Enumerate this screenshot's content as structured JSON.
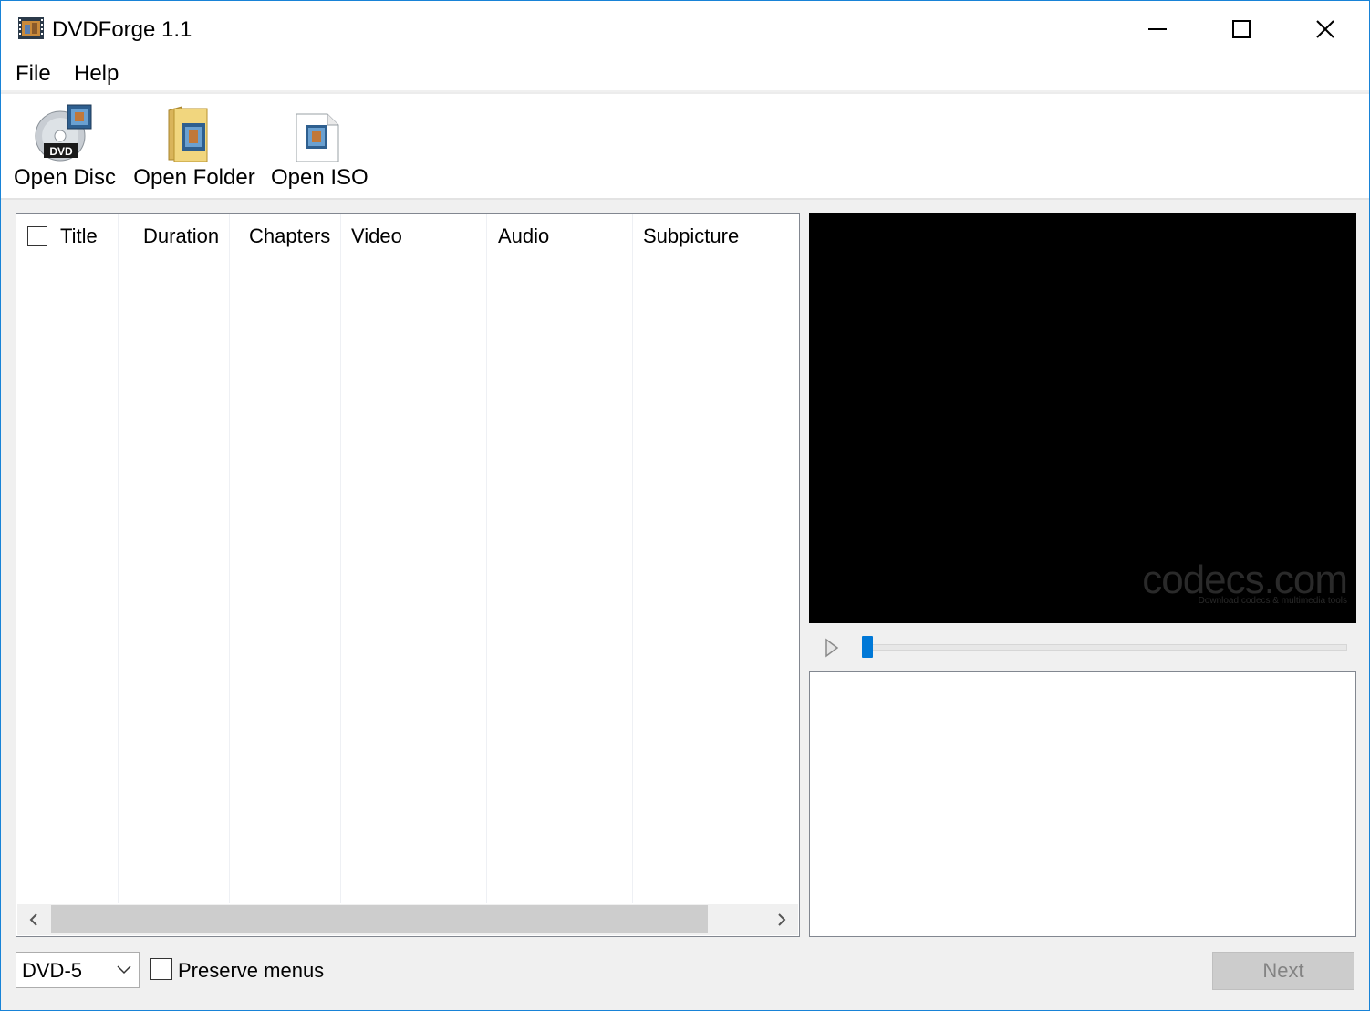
{
  "window": {
    "title": "DVDForge 1.1"
  },
  "menu": {
    "file": "File",
    "help": "Help"
  },
  "toolbar": {
    "open_disc": "Open Disc",
    "open_folder": "Open Folder",
    "open_iso": "Open ISO",
    "disc_badge": "DVD"
  },
  "table": {
    "columns": [
      "Title",
      "Duration",
      "Chapters",
      "Video",
      "Audio",
      "Subpicture"
    ],
    "rows": []
  },
  "video": {
    "watermark": "codecs.com",
    "watermark_sub": "Download codecs & multimedia tools"
  },
  "seek": {
    "position": 0
  },
  "bottom": {
    "disc_type": "DVD-5",
    "preserve_menus": "Preserve menus",
    "preserve_menus_checked": false,
    "next": "Next"
  },
  "colors": {
    "accent": "#0078d7",
    "border": "#1883d7"
  }
}
